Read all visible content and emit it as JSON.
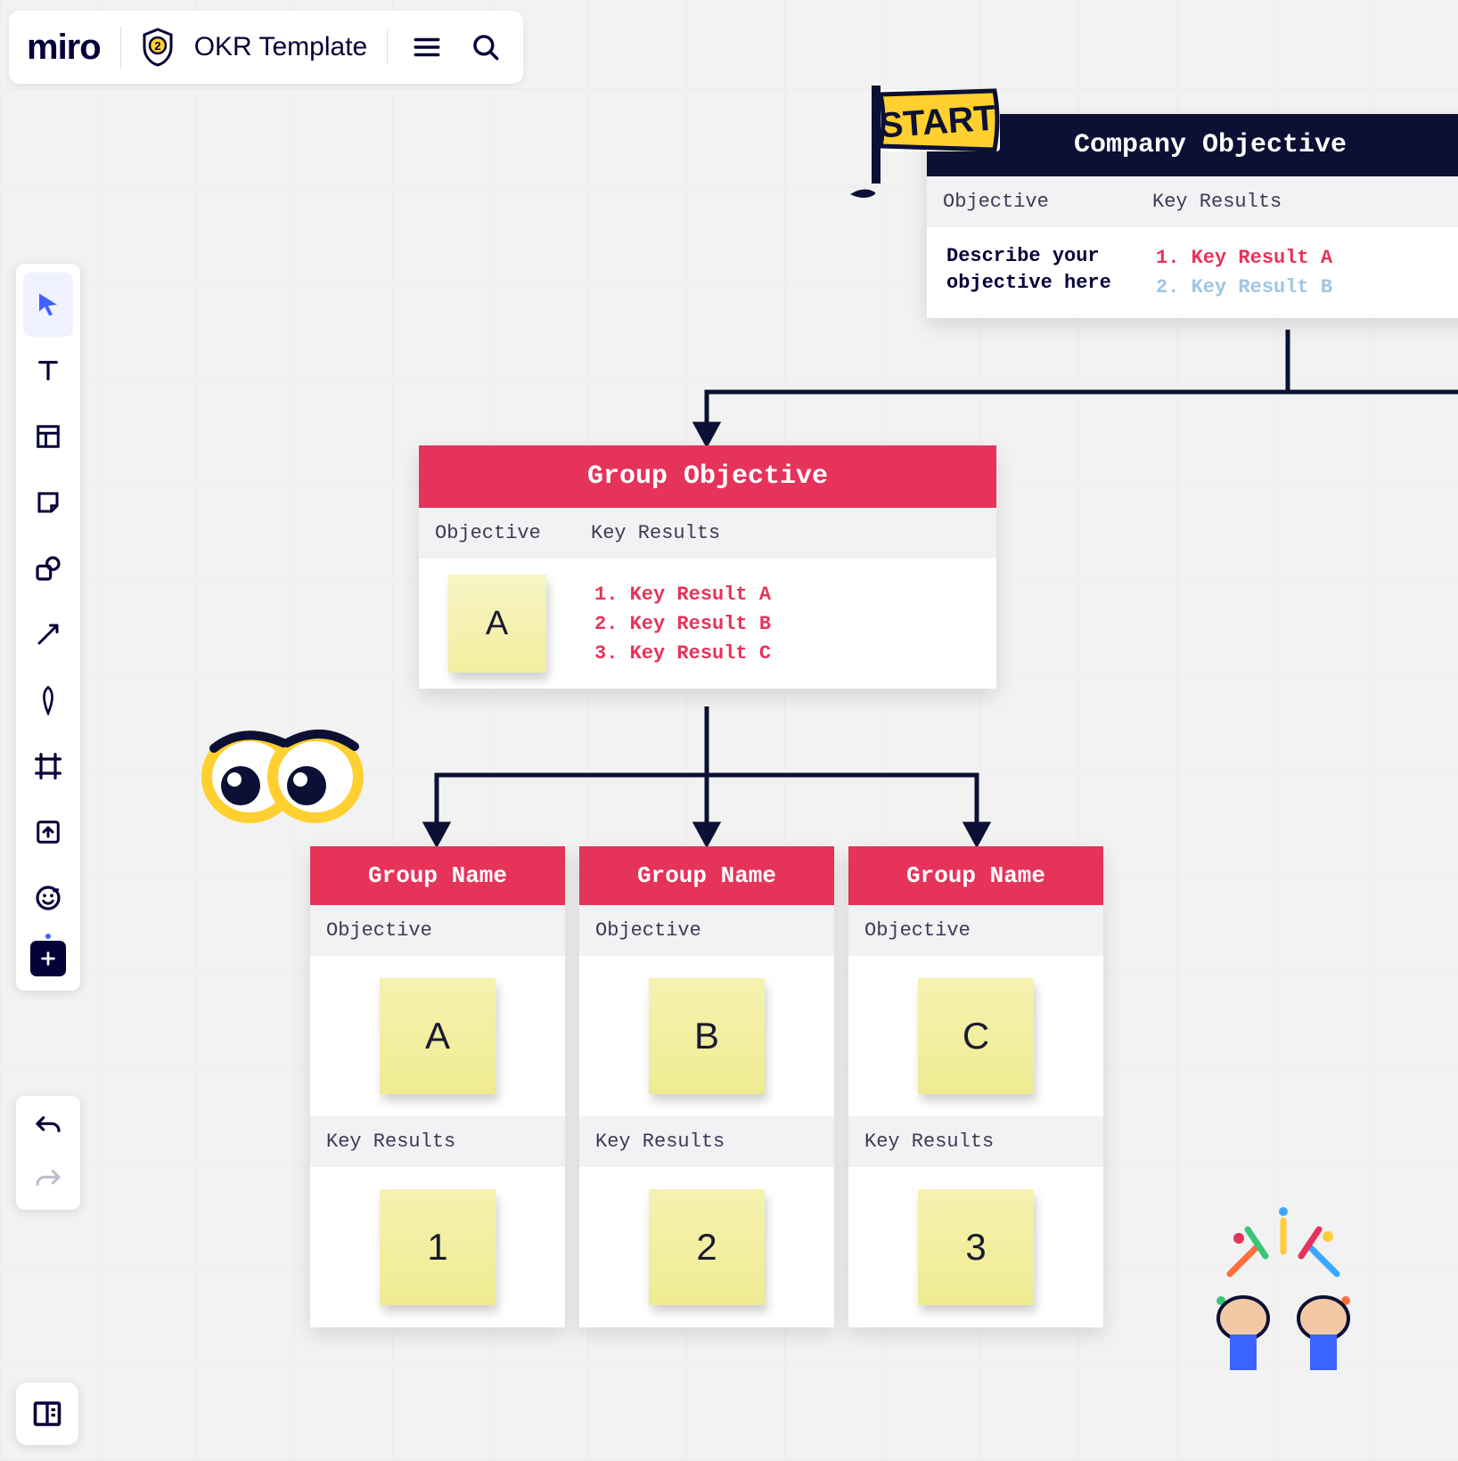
{
  "app": {
    "logo_text": "miro",
    "shield_badge": "2",
    "board_title": "OKR Template"
  },
  "toolbar": {
    "tools": [
      "select",
      "text",
      "template",
      "sticky-note",
      "shape",
      "arrow",
      "pen",
      "frame",
      "upload",
      "emoji",
      "add-more"
    ]
  },
  "stickers": {
    "start_label": "START"
  },
  "company_card": {
    "title": "Company Objective",
    "col_objective": "Objective",
    "col_key_results": "Key Results",
    "objective_text_l1": "Describe your",
    "objective_text_l2": "objective here",
    "kr": [
      {
        "num": "1.",
        "label": "Key Result A",
        "color": "ra"
      },
      {
        "num": "2.",
        "label": "Key Result B",
        "color": "rb"
      }
    ]
  },
  "group_objective_card": {
    "title": "Group Objective",
    "col_objective": "Objective",
    "col_key_results": "Key Results",
    "sticky_letter": "A",
    "kr": [
      {
        "num": "1.",
        "label": "Key Result A"
      },
      {
        "num": "2.",
        "label": "Key Result B"
      },
      {
        "num": "3.",
        "label": "Key Result C"
      }
    ]
  },
  "group_cards": [
    {
      "title": "Group Name",
      "obj_label": "Objective",
      "sticky_top": "A",
      "kr_label": "Key Results",
      "sticky_bottom": "1"
    },
    {
      "title": "Group Name",
      "obj_label": "Objective",
      "sticky_top": "B",
      "kr_label": "Key Results",
      "sticky_bottom": "2"
    },
    {
      "title": "Group Name",
      "obj_label": "Objective",
      "sticky_top": "C",
      "kr_label": "Key Results",
      "sticky_bottom": "3"
    }
  ]
}
